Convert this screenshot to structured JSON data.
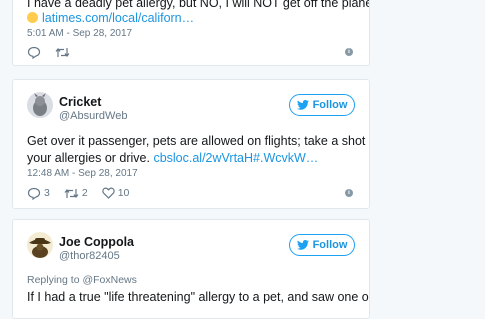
{
  "tweets": [
    {
      "text_line1": "I have a deadly pet allergy, but NO, I will NOT get off the plane.",
      "link": "latimes.com/local/californ…",
      "timestamp": "5:01 AM - Sep 28, 2017"
    },
    {
      "name": "Cricket",
      "handle": "@AbsurdWeb",
      "follow_label": "Follow",
      "text_line1": "Get over it passenger, pets are allowed on flights; take a shot for",
      "text_line2_prefix": "your allergies or drive.",
      "link": "cbsloc.al/2wVrtaH#.WcvkW…",
      "timestamp": "12:48 AM - Sep 28, 2017",
      "reply_count": "3",
      "retweet_count": "2",
      "like_count": "10"
    },
    {
      "name": "Joe Coppola",
      "handle": "@thor82405",
      "follow_label": "Follow",
      "replying_to": "Replying to @FoxNews",
      "text_line1": "If I had a true \"life threatening\" allergy to a pet, and saw one on"
    }
  ],
  "colors": {
    "accent": "#1da1f2",
    "link": "#1b95e0",
    "muted": "#657786",
    "background": "#f5f8fa"
  },
  "icons": [
    "reply-icon",
    "retweet-icon",
    "like-icon",
    "info-icon",
    "twitter-bird-icon",
    "thinking-emoji-icon"
  ]
}
